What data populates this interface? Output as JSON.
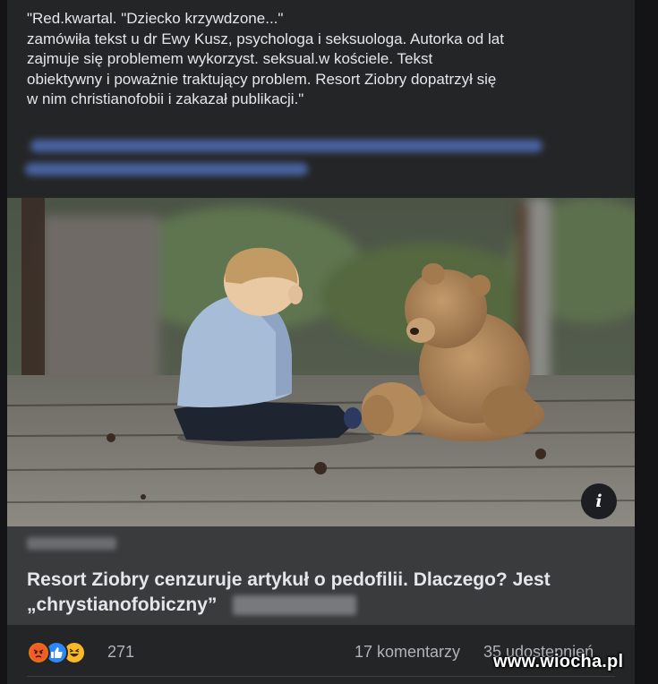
{
  "post": {
    "text_lines": [
      "\"Red.kwartal. \"Dziecko krzywdzone...\"",
      "zamówiła tekst u dr Ewy Kusz, psychologa i seksuologa. Autorka od lat",
      "zajmuje się problemem wykorzyst. seksual.w kościele. Tekst",
      "obiektywny i poważnie traktujący problem. Resort Ziobry dopatrzył się",
      "w nim christianofobii i zakazał publikacji.\""
    ]
  },
  "photo": {
    "info_icon": "info-icon",
    "info_glyph": "i"
  },
  "link_preview": {
    "title_lines": [
      "Resort Ziobry cenzuruje artykuł o pedofilii. Dlaczego? Jest",
      "„chrystianofobiczny”"
    ]
  },
  "engagement": {
    "reaction_icons": [
      "angry-reaction-icon",
      "like-reaction-icon",
      "haha-reaction-icon"
    ],
    "reaction_count": "271",
    "comments": "17 komentarzy",
    "shares": "35 udostępnień"
  },
  "watermark": "www.wiocha.pl",
  "colors": {
    "background": "#141416",
    "card": "#242526",
    "link_preview": "#3a3b3c",
    "text": "#e4e6eb",
    "secondary_text": "#b0b3b8",
    "like_blue": "#2d88ff",
    "angry_orange": "#e9710f",
    "haha_yellow": "#f7b928"
  }
}
